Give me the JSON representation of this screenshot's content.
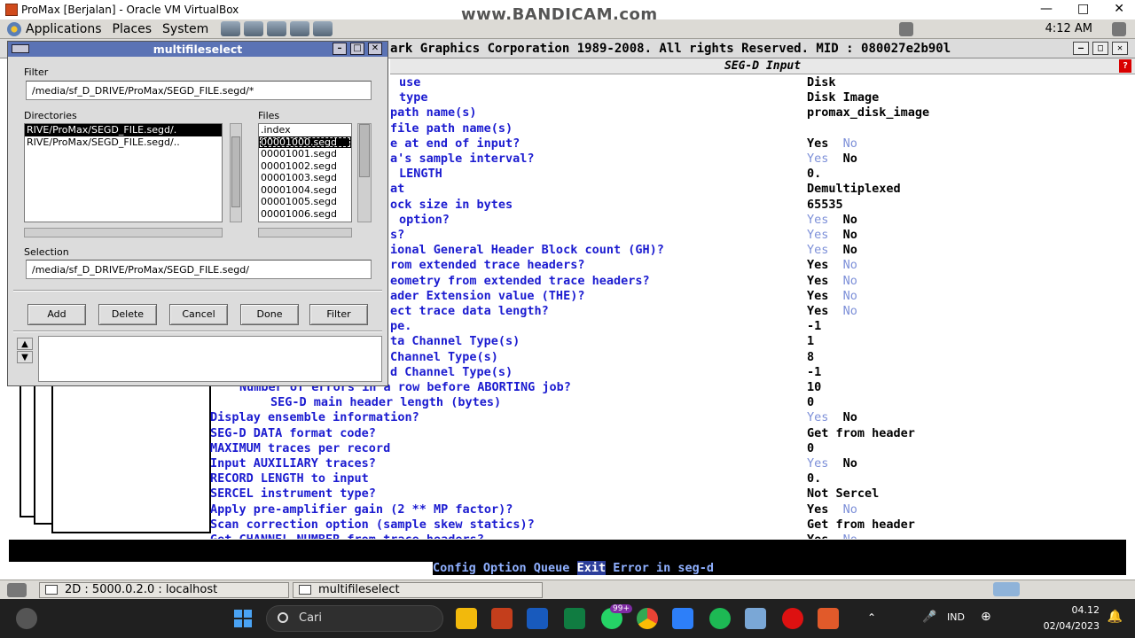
{
  "vbox": {
    "title": "ProMax [Berjalan] - Oracle VM VirtualBox",
    "minimize": "—",
    "maximize": "□",
    "close": "✕",
    "watermark": "www.BANDICAM.com"
  },
  "gnome_panel": {
    "menus": [
      "Applications",
      "Places",
      "System"
    ],
    "clock": "4:12 AM"
  },
  "promax": {
    "title": "ark Graphics Corporation 1989-2008. All rights Reserved.   MID : 080027e2b90l",
    "header": "SEG-D Input",
    "header_button": "?",
    "rows": [
      {
        "label": "use",
        "value": "Disk",
        "indent": 450
      },
      {
        "label": "type",
        "value": "Disk Image",
        "indent": 450
      },
      {
        "label": "path name(s)",
        "value": "promax_disk_image",
        "indent": 440
      },
      {
        "label": "file path name(s)",
        "value": "",
        "indent": 440
      },
      {
        "label": "e at end of input?",
        "yes": "Yes",
        "no": "No",
        "selected": "yes",
        "indent": 440
      },
      {
        "label": "a's sample interval?",
        "yes": "Yes",
        "no": "No",
        "selected": "no",
        "indent": 440
      },
      {
        "label": "LENGTH",
        "value": "0.",
        "indent": 450
      },
      {
        "label": "at",
        "value": "Demultiplexed",
        "indent": 440
      },
      {
        "label": "ock size in bytes",
        "value": "65535",
        "indent": 440
      },
      {
        "label": "option?",
        "yes": "Yes",
        "no": "No",
        "selected": "no",
        "indent": 450
      },
      {
        "label": "s?",
        "yes": "Yes",
        "no": "No",
        "selected": "no",
        "indent": 440
      },
      {
        "label": "ional General Header Block count (GH)?",
        "yes": "Yes",
        "no": "No",
        "selected": "no",
        "indent": 440
      },
      {
        "label": "rom extended trace headers?",
        "yes": "Yes",
        "no": "No",
        "selected": "yes",
        "indent": 440
      },
      {
        "label": "eometry from extended trace headers?",
        "yes": "Yes",
        "no": "No",
        "selected": "yes",
        "indent": 440
      },
      {
        "label": "ader Extension value (THE)?",
        "yes": "Yes",
        "no": "No",
        "selected": "yes",
        "indent": 440
      },
      {
        "label": "ect trace data length?",
        "yes": "Yes",
        "no": "No",
        "selected": "yes",
        "indent": 440
      },
      {
        "label": "pe.",
        "value": "-1",
        "indent": 440
      },
      {
        "label": "ta Channel Type(s)",
        "value": "1",
        "indent": 440
      },
      {
        "label": "Channel Type(s)",
        "value": "8",
        "indent": 440
      },
      {
        "label": "d Channel Type(s)",
        "value": "-1",
        "indent": 440
      },
      {
        "label": "Number of errors in a row before ABORTING job?",
        "value": "10",
        "indent": 270
      },
      {
        "label": "SEG-D main header length (bytes)",
        "value": "0",
        "indent": 305
      },
      {
        "label": "Display ensemble information?",
        "yes": "Yes",
        "no": "No",
        "selected": "no",
        "indent": 237
      },
      {
        "label": "SEG-D DATA format code?",
        "value": "Get from header",
        "indent": 237
      },
      {
        "label": "MAXIMUM traces per record",
        "value": "0",
        "indent": 237
      },
      {
        "label": "Input AUXILIARY traces?",
        "yes": "Yes",
        "no": "No",
        "selected": "no",
        "indent": 237
      },
      {
        "label": "RECORD LENGTH to input",
        "value": "0.",
        "indent": 237
      },
      {
        "label": "SERCEL instrument type?",
        "value": "Not Sercel",
        "indent": 237
      },
      {
        "label": "Apply pre-amplifier gain (2 ** MP factor)?",
        "yes": "Yes",
        "no": "No",
        "selected": "yes",
        "indent": 237
      },
      {
        "label": "Scan correction option (sample skew statics)?",
        "value": "Get from header",
        "indent": 237
      },
      {
        "label": "Get CHANNEL NUMBER from trace headers?",
        "yes": "Yes",
        "no": "No",
        "selected": "yes",
        "indent": 237
      }
    ],
    "status": {
      "config": "Config Option Queue ",
      "exit": "Exit",
      "error": " Error in seg-d"
    }
  },
  "gnome_taskbar": {
    "tasks": [
      "2D : 5000.0.2.0 : localhost",
      "multifileselect"
    ]
  },
  "dialog": {
    "title": "multifileselect",
    "filter_label": "Filter",
    "filter_value": "/media/sf_D_DRIVE/ProMax/SEGD_FILE.segd/*",
    "directories_label": "Directories",
    "directories": [
      "RIVE/ProMax/SEGD_FILE.segd/.",
      "RIVE/ProMax/SEGD_FILE.segd/.."
    ],
    "files_label": "Files",
    "files": [
      ".index",
      "00001000.segd",
      "00001001.segd",
      "00001002.segd",
      "00001003.segd",
      "00001004.segd",
      "00001005.segd",
      "00001006.segd"
    ],
    "selection_label": "Selection",
    "selection_value": "/media/sf_D_DRIVE/ProMax/SEGD_FILE.segd/",
    "buttons": {
      "add": "Add",
      "delete": "Delete",
      "cancel": "Cancel",
      "done": "Done",
      "filter": "Filter"
    }
  },
  "windows": {
    "search": "Cari",
    "lang": "IND",
    "time": "04.12",
    "date": "02/04/2023",
    "badge": "99+"
  }
}
